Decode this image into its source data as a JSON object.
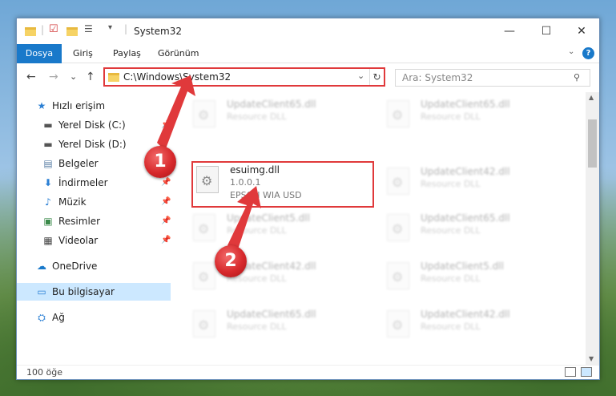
{
  "window": {
    "title": "System32",
    "controls": {
      "minimize": "—",
      "maximize": "☐",
      "close": "✕"
    }
  },
  "ribbon": {
    "tabs": [
      "Dosya",
      "Giriş",
      "Paylaş",
      "Görünüm"
    ],
    "help": "?"
  },
  "navigation": {
    "back": "←",
    "forward": "→",
    "recent": "⌄",
    "up": "↑",
    "address": "C:\\Windows\\System32",
    "refresh": "↻",
    "search_placeholder": "Ara: System32"
  },
  "sidebar": {
    "items": [
      {
        "label": "Hızlı erişim",
        "icon": "star-icon"
      },
      {
        "label": "Yerel Disk (C:)",
        "icon": "drive-icon"
      },
      {
        "label": "Yerel Disk (D:)",
        "icon": "drive-icon"
      },
      {
        "label": "Belgeler",
        "icon": "document-icon"
      },
      {
        "label": "İndirmeler",
        "icon": "download-icon"
      },
      {
        "label": "Müzik",
        "icon": "music-icon"
      },
      {
        "label": "Resimler",
        "icon": "picture-icon"
      },
      {
        "label": "Videolar",
        "icon": "video-icon"
      },
      {
        "label": "OneDrive",
        "icon": "cloud-icon"
      },
      {
        "label": "Bu bilgisayar",
        "icon": "computer-icon"
      },
      {
        "label": "Ağ",
        "icon": "network-icon"
      }
    ]
  },
  "files": [
    {
      "name": "UpdateClient65.dll",
      "type": "Resource DLL"
    },
    {
      "name": "UpdateClient65.dll",
      "type": "Resource DLL"
    },
    {
      "name": "esuimg.dll",
      "version": "1.0.0.1",
      "type": "EPSON WIA USD"
    },
    {
      "name": "UpdateClient42.dll",
      "type": "Resource DLL"
    },
    {
      "name": "UpdateClient5.dll",
      "type": "Resource DLL"
    },
    {
      "name": "UpdateClient65.dll",
      "type": "Resource DLL"
    },
    {
      "name": "UpdateClient42.dll",
      "type": "Resource DLL"
    },
    {
      "name": "UpdateClient5.dll",
      "type": "Resource DLL"
    },
    {
      "name": "UpdateClient65.dll",
      "type": "Resource DLL"
    },
    {
      "name": "UpdateClient42.dll",
      "type": "Resource DLL"
    }
  ],
  "status": {
    "count": "100 öğe"
  },
  "markers": [
    "1",
    "2"
  ],
  "colors": {
    "accent": "#1979ca",
    "highlight": "#e0393b",
    "selected": "#cce8ff"
  }
}
